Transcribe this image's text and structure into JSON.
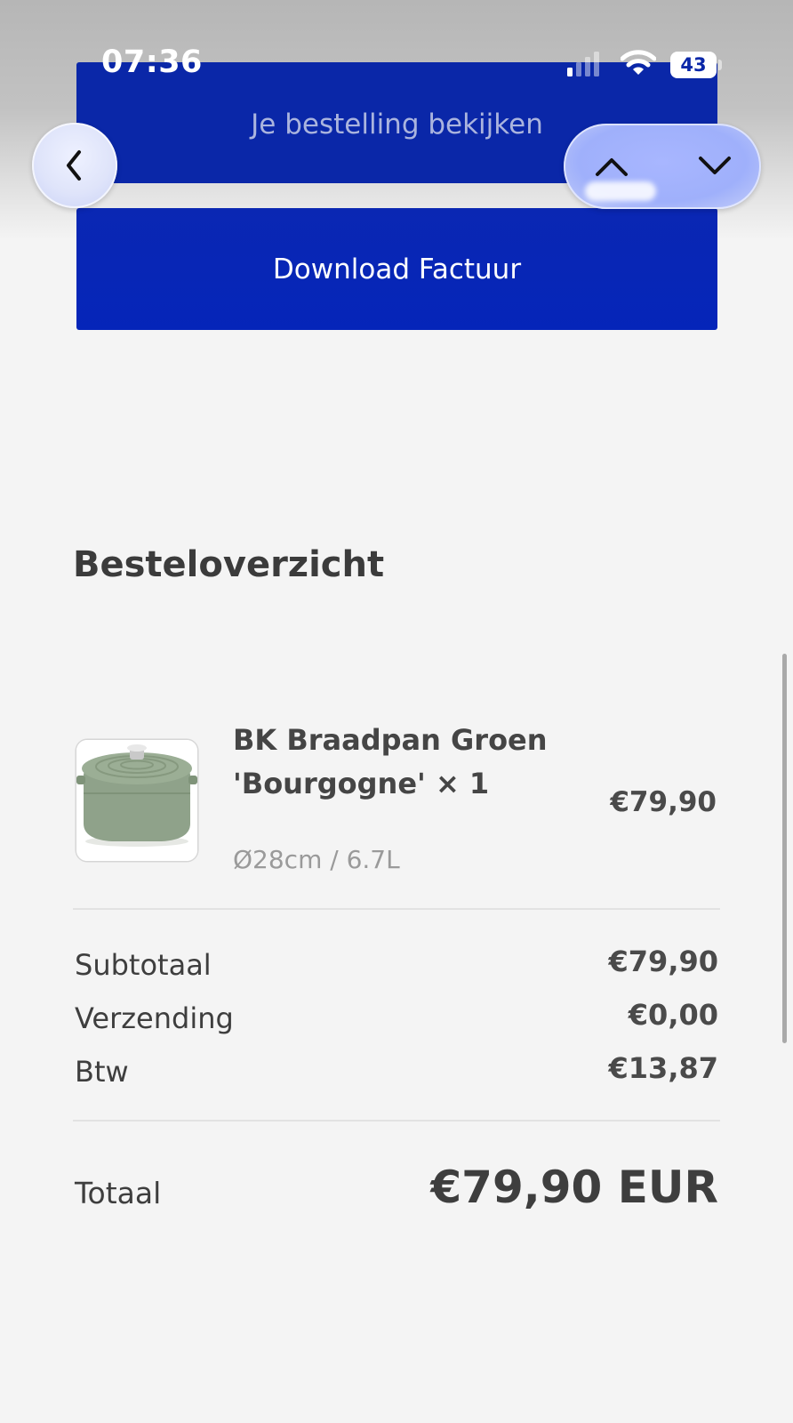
{
  "status_bar": {
    "time": "07:36",
    "battery": "43",
    "signal_icon": "cellular-signal-icon",
    "wifi_icon": "wifi-icon"
  },
  "nav": {
    "back_icon": "chevron-left-icon",
    "up_icon": "chevron-up-icon",
    "down_icon": "chevron-down-icon"
  },
  "buttons": {
    "view_order": "Je bestelling bekijken",
    "download_invoice": "Download Factuur"
  },
  "overview": {
    "title": "Besteloverzicht",
    "item": {
      "name": "BK Braadpan Groen 'Bourgogne' × 1",
      "variant": "Ø28cm / 6.7L",
      "price": "€79,90"
    },
    "rows": [
      {
        "label": "Subtotaal",
        "value": "€79,90"
      },
      {
        "label": "Verzending",
        "value": "€0,00"
      },
      {
        "label": "Btw",
        "value": "€13,87"
      }
    ],
    "total": {
      "label": "Totaal",
      "value": "€79,90 EUR"
    }
  },
  "colors": {
    "primary_button": "#0a27a8",
    "background": "#f4f4f4"
  }
}
